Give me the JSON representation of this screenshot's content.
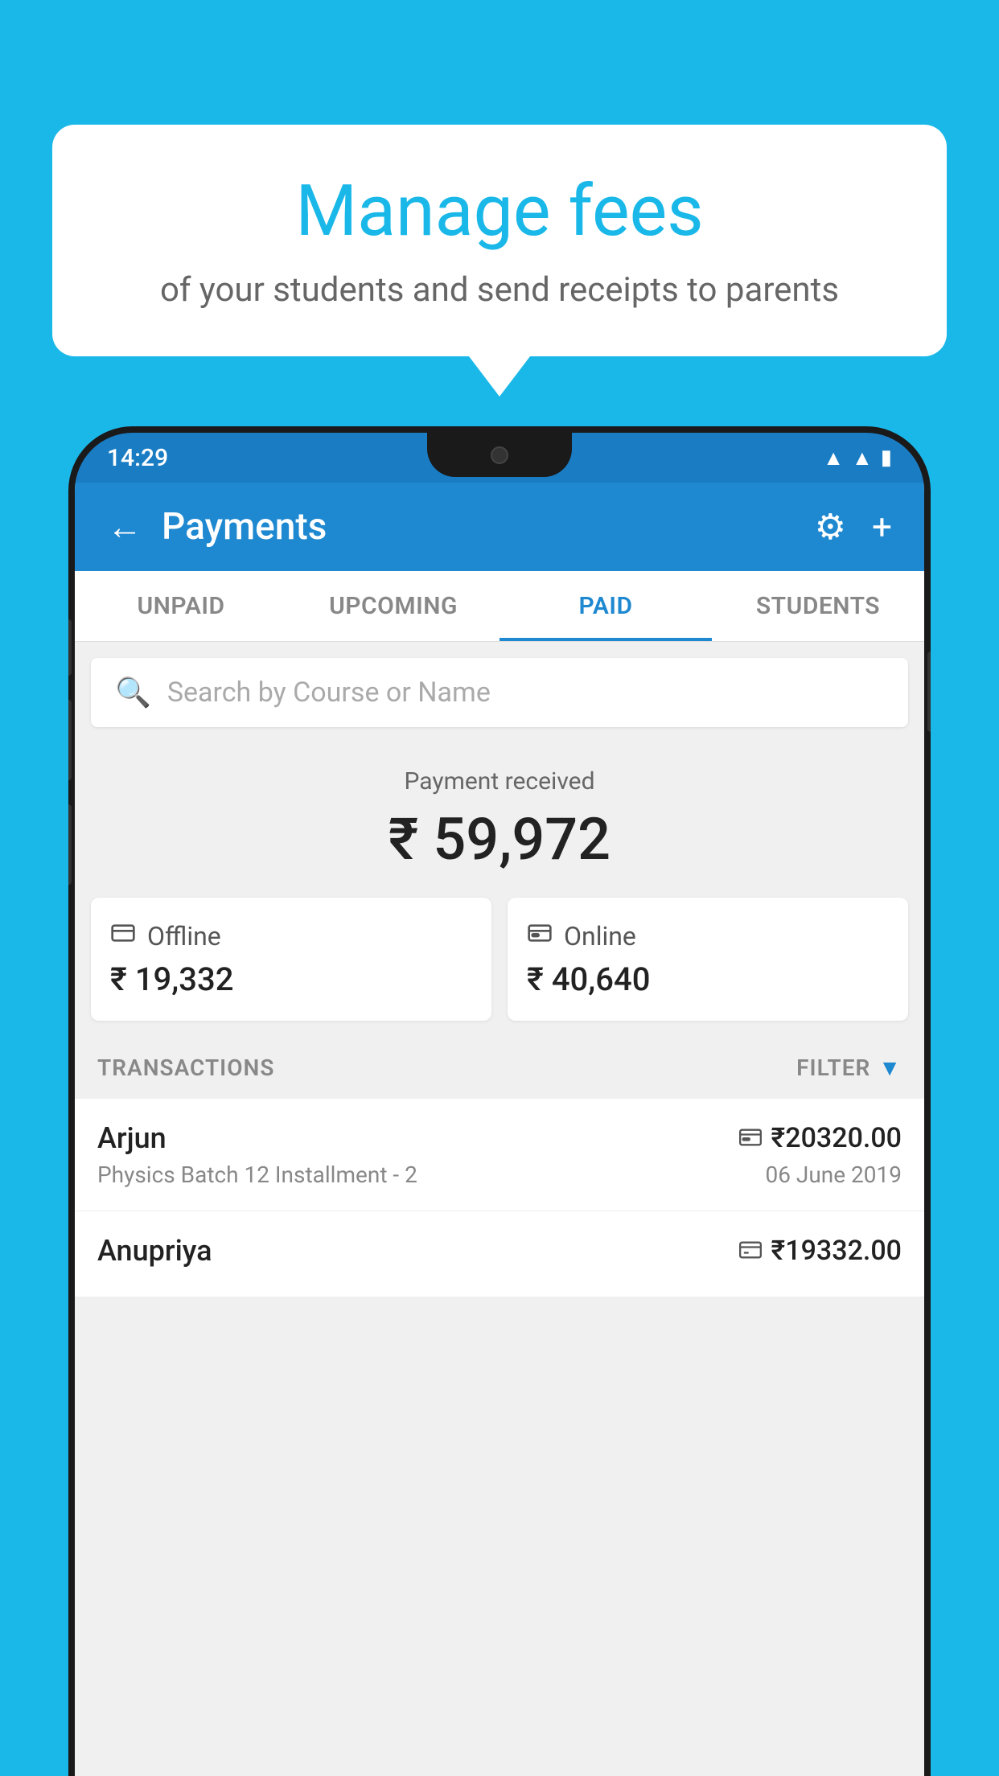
{
  "background_color": "#1ab8e8",
  "speech_bubble": {
    "title": "Manage fees",
    "subtitle": "of your students and send receipts to parents"
  },
  "status_bar": {
    "time": "14:29",
    "wifi": "▲",
    "signal": "▲",
    "battery": "▮"
  },
  "header": {
    "title": "Payments",
    "back_label": "←",
    "settings_label": "⚙",
    "add_label": "+"
  },
  "tabs": [
    {
      "id": "unpaid",
      "label": "UNPAID",
      "active": false
    },
    {
      "id": "upcoming",
      "label": "UPCOMING",
      "active": false
    },
    {
      "id": "paid",
      "label": "PAID",
      "active": true
    },
    {
      "id": "students",
      "label": "STUDENTS",
      "active": false
    }
  ],
  "search": {
    "placeholder": "Search by Course or Name"
  },
  "payment_received": {
    "label": "Payment received",
    "total": "₹ 59,972",
    "offline": {
      "icon": "💳",
      "label": "Offline",
      "amount": "₹ 19,332"
    },
    "online": {
      "icon": "💳",
      "label": "Online",
      "amount": "₹ 40,640"
    }
  },
  "transactions": {
    "header_label": "TRANSACTIONS",
    "filter_label": "FILTER",
    "items": [
      {
        "name": "Arjun",
        "course": "Physics Batch 12 Installment - 2",
        "amount": "₹20320.00",
        "date": "06 June 2019",
        "payment_type": "online"
      },
      {
        "name": "Anupriya",
        "course": "",
        "amount": "₹19332.00",
        "date": "",
        "payment_type": "offline"
      }
    ]
  }
}
